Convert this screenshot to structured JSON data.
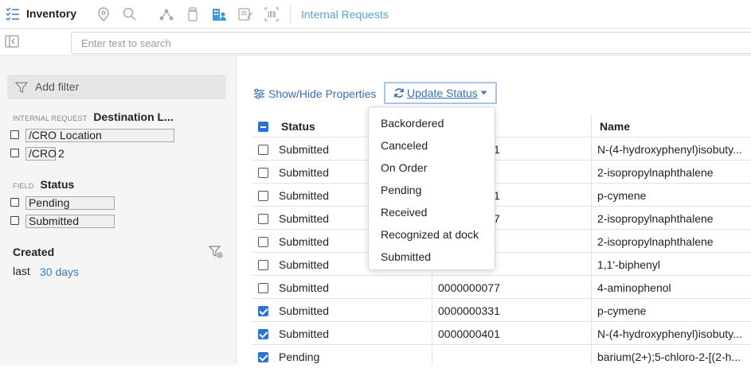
{
  "app": {
    "title": "Inventory"
  },
  "toolbar": {
    "tab_label": "Internal Requests"
  },
  "search": {
    "placeholder": "Enter text to search"
  },
  "sidebar": {
    "add_filter_label": "Add filter",
    "destination": {
      "category": "INTERNAL REQUEST",
      "name": "Destination L...",
      "options": [
        "/CRO Location",
        "/CRO",
        "2"
      ]
    },
    "status": {
      "category": "FIELD",
      "name": "Status",
      "options": [
        "Pending",
        "Submitted"
      ]
    },
    "created": {
      "label": "Created",
      "last_label": "last",
      "last_value": "30 days"
    }
  },
  "main": {
    "show_hide_label": "Show/Hide Properties",
    "update_status_label": "Update Status",
    "columns": {
      "status": "Status",
      "name": "Name"
    },
    "rows": [
      {
        "status": "Submitted",
        "id": "",
        "name": "N-(4-hydroxyphenyl)isobuty...",
        "checked": false
      },
      {
        "status": "Submitted",
        "id": "",
        "name": "2-isopropylnaphthalene",
        "checked": false
      },
      {
        "status": "Submitted",
        "id": "",
        "name": "p-cymene",
        "checked": false
      },
      {
        "status": "Submitted",
        "id": "",
        "name": "2-isopropylnaphthalene",
        "checked": false
      },
      {
        "status": "Submitted",
        "id": "",
        "name": "2-isopropylnaphthalene",
        "checked": false
      },
      {
        "status": "Submitted",
        "id": "",
        "name": "1,1'-biphenyl",
        "checked": false
      },
      {
        "status": "Submitted",
        "id": "0000000077",
        "name": "4-aminophenol",
        "checked": false
      },
      {
        "status": "Submitted",
        "id": "0000000331",
        "name": "p-cymene",
        "checked": true
      },
      {
        "status": "Submitted",
        "id": "0000000401",
        "name": "N-(4-hydroxyphenyl)isobuty...",
        "checked": true
      },
      {
        "status": "Pending",
        "id": "",
        "name": "barium(2+);5-chloro-2-[(2-h...",
        "checked": true
      }
    ],
    "partial_ids": [
      "1",
      "",
      "1",
      "7",
      "",
      ""
    ]
  },
  "dropdown": {
    "items": [
      "Backordered",
      "Canceled",
      "On Order",
      "Pending",
      "Received",
      "Recognized at dock",
      "Submitted"
    ]
  },
  "colors": {
    "accent": "#2a73d8",
    "link": "#3a6fb5",
    "tab": "#5a9fd4"
  }
}
